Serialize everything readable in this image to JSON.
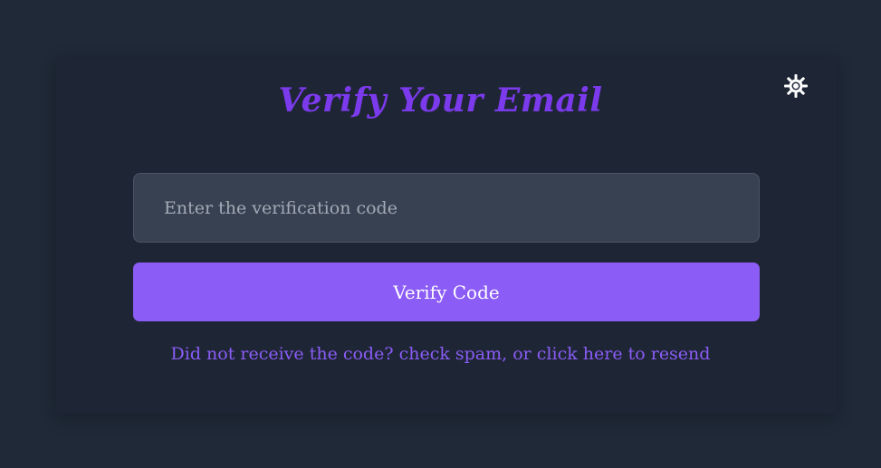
{
  "page": {
    "title": "Verify Your Email",
    "theme_toggle_icon": "sun-icon"
  },
  "form": {
    "code_input": {
      "value": "",
      "placeholder": "Enter the verification code"
    },
    "submit_label": "Verify Code",
    "resend_text": "Did not receive the code? check spam, or click here to resend"
  },
  "colors": {
    "background": "#1f2937",
    "card": "#1e2636",
    "accent": "#8b5cf6",
    "title": "#7c3aed",
    "input_bg": "#374151"
  }
}
